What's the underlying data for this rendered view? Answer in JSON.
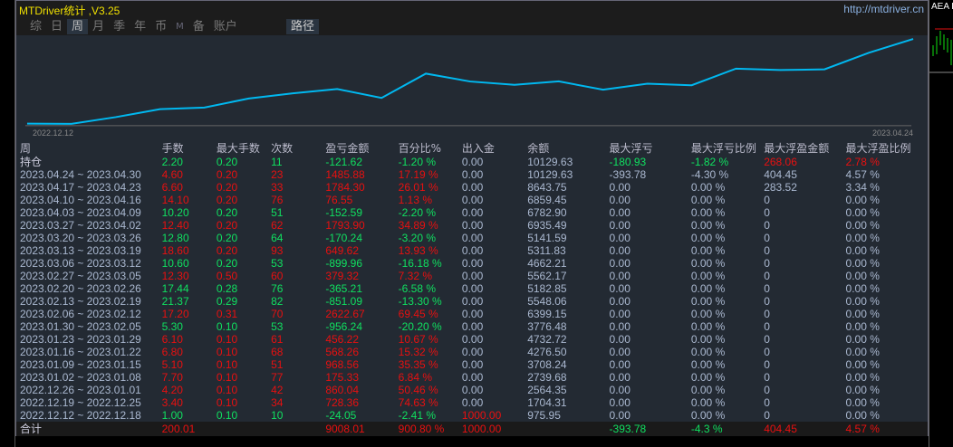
{
  "header": {
    "title": "MTDriver统计 ,V3.25",
    "url": "http://mtdriver.cn",
    "right_label": "AEA D"
  },
  "tabs": [
    {
      "label": "综",
      "active": false
    },
    {
      "label": "日",
      "active": false
    },
    {
      "label": "周",
      "active": true
    },
    {
      "label": "月",
      "active": false
    },
    {
      "label": "季",
      "active": false
    },
    {
      "label": "年",
      "active": false
    },
    {
      "label": "币",
      "active": false
    },
    {
      "label": "M",
      "active": false
    },
    {
      "label": "备",
      "active": false
    },
    {
      "label": "账户",
      "active": false
    }
  ],
  "path_tab": "路径",
  "chart_data": {
    "type": "line",
    "start_label": "2022.12.12",
    "end_label": "2023.04.24",
    "values": [
      1000,
      975.95,
      1704.31,
      2564.35,
      2739.68,
      3708.24,
      4276.5,
      4732.72,
      3776.48,
      6399.15,
      5548.06,
      5182.85,
      5562.17,
      4662.21,
      5311.83,
      5141.59,
      6935.49,
      6782.9,
      6859.45,
      8643.75,
      10129.63
    ],
    "color": "#00b8f0"
  },
  "columns": [
    "周",
    "手数",
    "最大手数",
    "次数",
    "盈亏金额",
    "百分比%",
    "出入金",
    "余额",
    "最大浮亏",
    "最大浮亏比例",
    "最大浮盈金额",
    "最大浮盈比例"
  ],
  "holding": {
    "label": "持仓",
    "cells": [
      [
        "2.20",
        "g"
      ],
      [
        "0.20",
        "g"
      ],
      [
        "11",
        "g"
      ],
      [
        "-121.62",
        "g"
      ],
      [
        "-1.20 %",
        "g"
      ],
      [
        "0.00",
        "n"
      ],
      [
        "10129.63",
        "n"
      ],
      [
        "-180.93",
        "g"
      ],
      [
        "-1.82 %",
        "g"
      ],
      [
        "268.06",
        "r"
      ],
      [
        "2.78 %",
        "r"
      ]
    ]
  },
  "rows": [
    {
      "period": "2023.04.24 ~ 2023.04.30",
      "c": "r",
      "lots": "4.60",
      "max_lots": "0.20",
      "count": "23",
      "pnl": "1485.88",
      "pct": "17.19 %",
      "io": "0.00",
      "bal": "10129.63",
      "mdd": "-393.78",
      "mddp": "-4.30 %",
      "mfe": "404.45",
      "mfep": "4.57 %"
    },
    {
      "period": "2023.04.17 ~ 2023.04.23",
      "c": "r",
      "lots": "6.60",
      "max_lots": "0.20",
      "count": "33",
      "pnl": "1784.30",
      "pct": "26.01 %",
      "io": "0.00",
      "bal": "8643.75",
      "mdd": "0.00",
      "mddp": "0.00 %",
      "mfe": "283.52",
      "mfep": "3.34 %"
    },
    {
      "period": "2023.04.10 ~ 2023.04.16",
      "c": "r",
      "lots": "14.10",
      "max_lots": "0.20",
      "count": "76",
      "pnl": "76.55",
      "pct": "1.13 %",
      "io": "0.00",
      "bal": "6859.45",
      "mdd": "0.00",
      "mddp": "0.00 %",
      "mfe": "0",
      "mfep": "0.00 %"
    },
    {
      "period": "2023.04.03 ~ 2023.04.09",
      "c": "g",
      "lots": "10.20",
      "max_lots": "0.20",
      "count": "51",
      "pnl": "-152.59",
      "pct": "-2.20 %",
      "io": "0.00",
      "bal": "6782.90",
      "mdd": "0.00",
      "mddp": "0.00 %",
      "mfe": "0",
      "mfep": "0.00 %"
    },
    {
      "period": "2023.03.27 ~ 2023.04.02",
      "c": "r",
      "lots": "12.40",
      "max_lots": "0.20",
      "count": "62",
      "pnl": "1793.90",
      "pct": "34.89 %",
      "io": "0.00",
      "bal": "6935.49",
      "mdd": "0.00",
      "mddp": "0.00 %",
      "mfe": "0",
      "mfep": "0.00 %"
    },
    {
      "period": "2023.03.20 ~ 2023.03.26",
      "c": "g",
      "lots": "12.80",
      "max_lots": "0.20",
      "count": "64",
      "pnl": "-170.24",
      "pct": "-3.20 %",
      "io": "0.00",
      "bal": "5141.59",
      "mdd": "0.00",
      "mddp": "0.00 %",
      "mfe": "0",
      "mfep": "0.00 %"
    },
    {
      "period": "2023.03.13 ~ 2023.03.19",
      "c": "r",
      "lots": "18.60",
      "max_lots": "0.20",
      "count": "93",
      "pnl": "649.62",
      "pct": "13.93 %",
      "io": "0.00",
      "bal": "5311.83",
      "mdd": "0.00",
      "mddp": "0.00 %",
      "mfe": "0",
      "mfep": "0.00 %"
    },
    {
      "period": "2023.03.06 ~ 2023.03.12",
      "c": "g",
      "lots": "10.60",
      "max_lots": "0.20",
      "count": "53",
      "pnl": "-899.96",
      "pct": "-16.18 %",
      "io": "0.00",
      "bal": "4662.21",
      "mdd": "0.00",
      "mddp": "0.00 %",
      "mfe": "0",
      "mfep": "0.00 %"
    },
    {
      "period": "2023.02.27 ~ 2023.03.05",
      "c": "r",
      "lots": "12.30",
      "max_lots": "0.50",
      "count": "60",
      "pnl": "379.32",
      "pct": "7.32 %",
      "io": "0.00",
      "bal": "5562.17",
      "mdd": "0.00",
      "mddp": "0.00 %",
      "mfe": "0",
      "mfep": "0.00 %"
    },
    {
      "period": "2023.02.20 ~ 2023.02.26",
      "c": "g",
      "lots": "17.44",
      "max_lots": "0.28",
      "count": "76",
      "pnl": "-365.21",
      "pct": "-6.58 %",
      "io": "0.00",
      "bal": "5182.85",
      "mdd": "0.00",
      "mddp": "0.00 %",
      "mfe": "0",
      "mfep": "0.00 %"
    },
    {
      "period": "2023.02.13 ~ 2023.02.19",
      "c": "g",
      "lots": "21.37",
      "max_lots": "0.29",
      "count": "82",
      "pnl": "-851.09",
      "pct": "-13.30 %",
      "io": "0.00",
      "bal": "5548.06",
      "mdd": "0.00",
      "mddp": "0.00 %",
      "mfe": "0",
      "mfep": "0.00 %"
    },
    {
      "period": "2023.02.06 ~ 2023.02.12",
      "c": "r",
      "lots": "17.20",
      "max_lots": "0.31",
      "count": "70",
      "pnl": "2622.67",
      "pct": "69.45 %",
      "io": "0.00",
      "bal": "6399.15",
      "mdd": "0.00",
      "mddp": "0.00 %",
      "mfe": "0",
      "mfep": "0.00 %"
    },
    {
      "period": "2023.01.30 ~ 2023.02.05",
      "c": "g",
      "lots": "5.30",
      "max_lots": "0.10",
      "count": "53",
      "pnl": "-956.24",
      "pct": "-20.20 %",
      "io": "0.00",
      "bal": "3776.48",
      "mdd": "0.00",
      "mddp": "0.00 %",
      "mfe": "0",
      "mfep": "0.00 %"
    },
    {
      "period": "2023.01.23 ~ 2023.01.29",
      "c": "r",
      "lots": "6.10",
      "max_lots": "0.10",
      "count": "61",
      "pnl": "456.22",
      "pct": "10.67 %",
      "io": "0.00",
      "bal": "4732.72",
      "mdd": "0.00",
      "mddp": "0.00 %",
      "mfe": "0",
      "mfep": "0.00 %"
    },
    {
      "period": "2023.01.16 ~ 2023.01.22",
      "c": "r",
      "lots": "6.80",
      "max_lots": "0.10",
      "count": "68",
      "pnl": "568.26",
      "pct": "15.32 %",
      "io": "0.00",
      "bal": "4276.50",
      "mdd": "0.00",
      "mddp": "0.00 %",
      "mfe": "0",
      "mfep": "0.00 %"
    },
    {
      "period": "2023.01.09 ~ 2023.01.15",
      "c": "r",
      "lots": "5.10",
      "max_lots": "0.10",
      "count": "51",
      "pnl": "968.56",
      "pct": "35.35 %",
      "io": "0.00",
      "bal": "3708.24",
      "mdd": "0.00",
      "mddp": "0.00 %",
      "mfe": "0",
      "mfep": "0.00 %"
    },
    {
      "period": "2023.01.02 ~ 2023.01.08",
      "c": "r",
      "lots": "7.70",
      "max_lots": "0.10",
      "count": "77",
      "pnl": "175.33",
      "pct": "6.84 %",
      "io": "0.00",
      "bal": "2739.68",
      "mdd": "0.00",
      "mddp": "0.00 %",
      "mfe": "0",
      "mfep": "0.00 %"
    },
    {
      "period": "2022.12.26 ~ 2023.01.01",
      "c": "r",
      "lots": "4.20",
      "max_lots": "0.10",
      "count": "42",
      "pnl": "860.04",
      "pct": "50.46 %",
      "io": "0.00",
      "bal": "2564.35",
      "mdd": "0.00",
      "mddp": "0.00 %",
      "mfe": "0",
      "mfep": "0.00 %"
    },
    {
      "period": "2022.12.19 ~ 2022.12.25",
      "c": "r",
      "lots": "3.40",
      "max_lots": "0.10",
      "count": "34",
      "pnl": "728.36",
      "pct": "74.63 %",
      "io": "0.00",
      "bal": "1704.31",
      "mdd": "0.00",
      "mddp": "0.00 %",
      "mfe": "0",
      "mfep": "0.00 %"
    },
    {
      "period": "2022.12.12 ~ 2022.12.18",
      "c": "g",
      "lots": "1.00",
      "max_lots": "0.10",
      "count": "10",
      "pnl": "-24.05",
      "pct": "-2.41 %",
      "io": "1000.00",
      "bal": "975.95",
      "mdd": "0.00",
      "mddp": "0.00 %",
      "mfe": "0",
      "mfep": "0.00 %",
      "io_c": "r"
    }
  ],
  "total": {
    "label": "合计",
    "cells": [
      [
        "200.01",
        "r"
      ],
      [
        "",
        ""
      ],
      [
        "",
        ""
      ],
      [
        "9008.01",
        "r"
      ],
      [
        "900.80 %",
        "r"
      ],
      [
        "1000.00",
        "r"
      ],
      [
        "",
        ""
      ],
      [
        "-393.78",
        "g"
      ],
      [
        "-4.3 %",
        "g"
      ],
      [
        "404.45",
        "r"
      ],
      [
        "4.57 %",
        "r"
      ]
    ]
  }
}
